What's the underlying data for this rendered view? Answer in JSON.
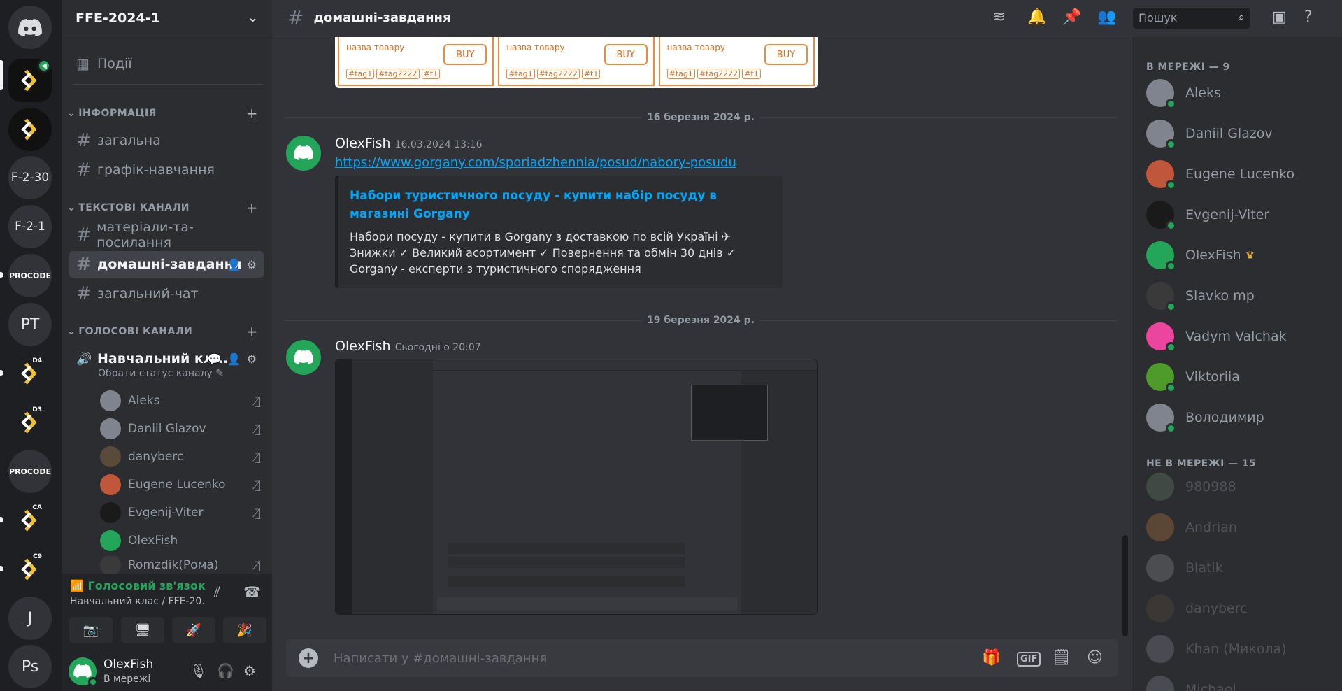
{
  "colors": {
    "accent": "#5865f2",
    "online": "#23a55a",
    "link": "#00a8fc"
  },
  "guild": {
    "name": "FFE-2024-1"
  },
  "servers": [
    {
      "label": ""
    },
    {
      "label": ""
    },
    {
      "label": ""
    },
    {
      "label": "F-2-30"
    },
    {
      "label": "F-2-1"
    },
    {
      "label": "PROCODE"
    },
    {
      "label": "PT"
    },
    {
      "label": "D4"
    },
    {
      "label": "D3"
    },
    {
      "label": "PROCODE"
    },
    {
      "label": "CA"
    },
    {
      "label": "C9"
    },
    {
      "label": "J"
    },
    {
      "label": "Ps"
    }
  ],
  "sidebar": {
    "events_label": "Події",
    "categories": {
      "info": "ІНФОРМАЦІЯ",
      "text": "ТЕКСТОВІ КАНАЛИ",
      "voice": "ГОЛОСОВІ КАНАЛИ"
    },
    "channels": {
      "general": "загальна",
      "schedule": "графік-навчання",
      "materials": "матеріали-та-посилання",
      "homework": "домашні-завдання",
      "general_chat": "загальний-чат"
    },
    "voice_channel": {
      "name": "Навчальний кл...",
      "status": "Обрати статус каналу"
    },
    "voice_users": [
      "Aleks",
      "Daniil Glazov",
      "danyberc",
      "Eugene Lucenko",
      "Evgenij-Viter",
      "OlexFish",
      "Romzdik(Рома)"
    ]
  },
  "voice_panel": {
    "status": "Голосовий зв'язок пі",
    "channel": "Навчальний клас / FFE-20..."
  },
  "user": {
    "name": "OlexFish",
    "status": "В мережі"
  },
  "topbar": {
    "channel": "домашні-завдання",
    "search_placeholder": "Пошук"
  },
  "chat": {
    "product_cards": [
      {
        "name": "назва товару",
        "buy": "BUY",
        "tags": [
          "#tag1",
          "#tag2222",
          "#t1"
        ]
      },
      {
        "name": "назва товару",
        "buy": "BUY",
        "tags": [
          "#tag1",
          "#tag2222",
          "#t1"
        ]
      },
      {
        "name": "назва товару",
        "buy": "BUY",
        "tags": [
          "#tag1",
          "#tag2222",
          "#t1"
        ]
      }
    ],
    "divider1": "16 березня 2024 р.",
    "msg1": {
      "author": "OlexFish",
      "time": "16.03.2024 13:16",
      "link": "https://www.gorgany.com/sporiadzhennia/posud/nabory-posudu",
      "embed_title": "Набори туристичного посуду - купити набір посуду в магазині Gorgany",
      "embed_desc": "Набори посуду - купити в Gorgany з доставкою по всій Україні ✈ Знижки ✓ Великий асортимент ✓ Повернення та обмін 30 днів ✓ Gorgany - експерти з туристичного спорядження"
    },
    "divider2": "19 березня 2024 р.",
    "msg2": {
      "author": "OlexFish",
      "time": "Сьогодні о 20:07"
    },
    "composer_placeholder": "Написати у #домашні-завдання"
  },
  "members": {
    "online_header": "В МЕРЕЖІ — 9",
    "online": [
      {
        "name": "Aleks",
        "color": "#80848e"
      },
      {
        "name": "Daniil Glazov",
        "color": "#80848e"
      },
      {
        "name": "Eugene Lucenko",
        "color": "#c0563a"
      },
      {
        "name": "Evgenij-Viter",
        "color": "#1a1a1a"
      },
      {
        "name": "OlexFish",
        "color": "#23a55a"
      },
      {
        "name": "Slavko mp",
        "color": "#3a3a3a"
      },
      {
        "name": "Vadym Valchak",
        "color": "#eb459e"
      },
      {
        "name": "Viktoriia",
        "color": "#4e9a2a"
      },
      {
        "name": "Володимир",
        "color": "#80848e"
      }
    ],
    "offline_header": "НЕ В МЕРЕЖІ — 15",
    "offline": [
      {
        "name": "980988",
        "color": "#6b7f6b"
      },
      {
        "name": "Andrian",
        "color": "#b8763a"
      },
      {
        "name": "Blatik",
        "color": "#8a8a8a"
      },
      {
        "name": "danyberc",
        "color": "#5a4a3a"
      },
      {
        "name": "Khan (Микола)",
        "color": "#80848e"
      },
      {
        "name": "Michael",
        "color": "#80848e"
      }
    ]
  }
}
